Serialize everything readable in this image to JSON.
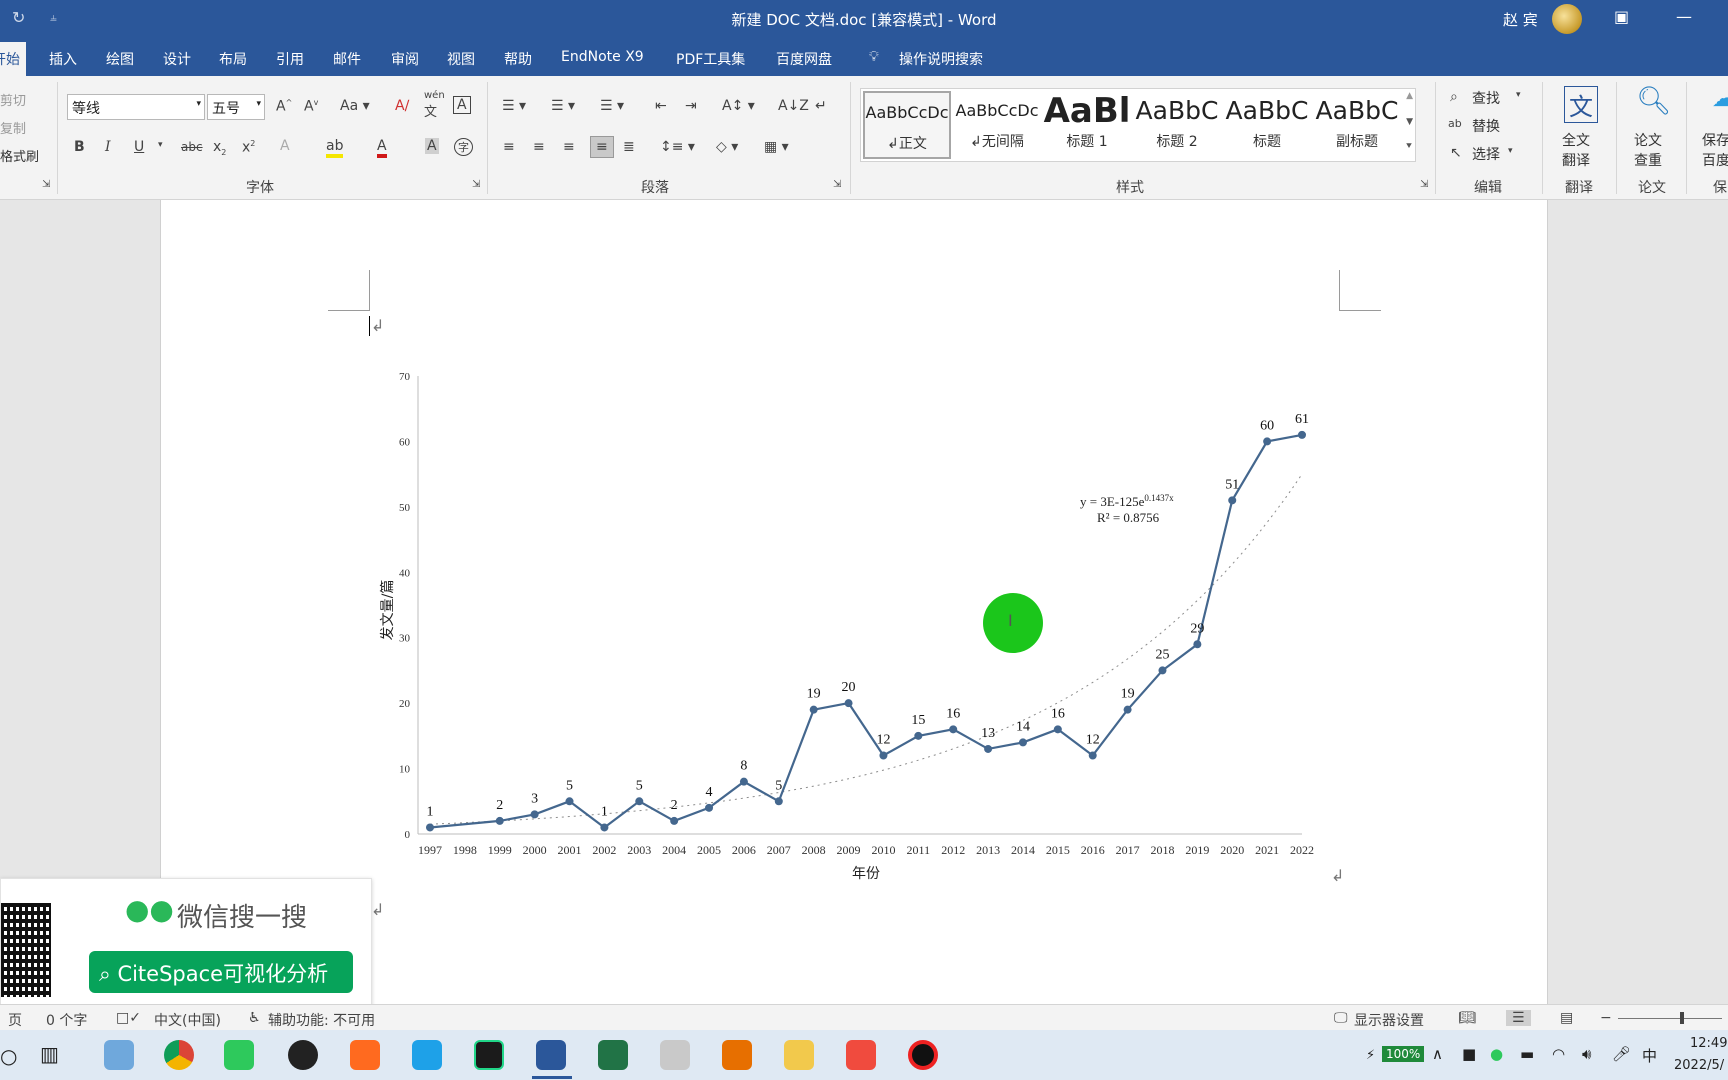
{
  "window": {
    "title": "新建 DOC 文档.doc [兼容模式]  -  Word",
    "user": "赵 宾"
  },
  "menu": {
    "tabs": [
      "开始",
      "插入",
      "绘图",
      "设计",
      "布局",
      "引用",
      "邮件",
      "审阅",
      "视图",
      "帮助",
      "EndNote X9",
      "PDF工具集",
      "百度网盘"
    ],
    "search": "操作说明搜索"
  },
  "ribbon": {
    "clipboard": {
      "cut": "剪切",
      "copy": "复制",
      "format_painter": "格式刷"
    },
    "font": {
      "name": "等线",
      "size": "五号",
      "label": "字体",
      "change_case": "Aa",
      "phonetic": "wén",
      "phonetic_char": "文"
    },
    "paragraph": {
      "label": "段落"
    },
    "styles": {
      "label": "样式",
      "items": [
        {
          "preview": "AaBbCcDc",
          "name": "正文"
        },
        {
          "preview": "AaBbCcDc",
          "name": "无间隔"
        },
        {
          "preview": "AaBl",
          "name": "标题 1"
        },
        {
          "preview": "AaBbC",
          "name": "标题 2"
        },
        {
          "preview": "AaBbC",
          "name": "标题"
        },
        {
          "preview": "AaBbC",
          "name": "副标题"
        }
      ]
    },
    "editing": {
      "find": "查找",
      "replace": "替换",
      "select": "选择",
      "label": "编辑"
    },
    "translate": {
      "button": "全文\n翻译",
      "label": "翻译"
    },
    "paper": {
      "button": "论文\n查重",
      "label": "论文"
    },
    "save": {
      "button": "保存\n百度",
      "label": "保"
    }
  },
  "chart_data": {
    "type": "line",
    "x": [
      "1997",
      "1998",
      "1999",
      "2000",
      "2001",
      "2002",
      "2003",
      "2004",
      "2005",
      "2006",
      "2007",
      "2008",
      "2009",
      "2010",
      "2011",
      "2012",
      "2013",
      "2014",
      "2015",
      "2016",
      "2017",
      "2018",
      "2019",
      "2020",
      "2021",
      "2022"
    ],
    "values": [
      1,
      2,
      3,
      5,
      1,
      5,
      2,
      4,
      8,
      5,
      19,
      20,
      12,
      15,
      16,
      13,
      14,
      16,
      12,
      19,
      25,
      29,
      51,
      60,
      61
    ],
    "value_positions": [
      0,
      2,
      3,
      4,
      5,
      6,
      7,
      8,
      9,
      10,
      11,
      12,
      13,
      14,
      15,
      16,
      17,
      18,
      19,
      20,
      21,
      22,
      23,
      24,
      25
    ],
    "xlabel": "年份",
    "ylabel": "发文量/篇",
    "ylim": [
      0,
      70
    ],
    "yticks": [
      0,
      10,
      20,
      30,
      40,
      50,
      60,
      70
    ],
    "grid": false,
    "trendline": {
      "type": "exponential",
      "equation": "y = 3E-125e",
      "exponent": "0.1437x",
      "r2": "R² = 0.8756",
      "start_value": 1.5,
      "end_value": 55
    },
    "line_color": "#44678e"
  },
  "status": {
    "page": "页",
    "words": "0 个字",
    "language": "中文(中国)",
    "accessibility": "辅助功能: 不可用",
    "display": "显示器设置"
  },
  "overlay": {
    "title": "微信搜一搜",
    "button": "CiteSpace可视化分析"
  },
  "taskbar": {
    "battery": "100%",
    "time": "12:49",
    "date": "2022/5/",
    "ime": "中"
  }
}
